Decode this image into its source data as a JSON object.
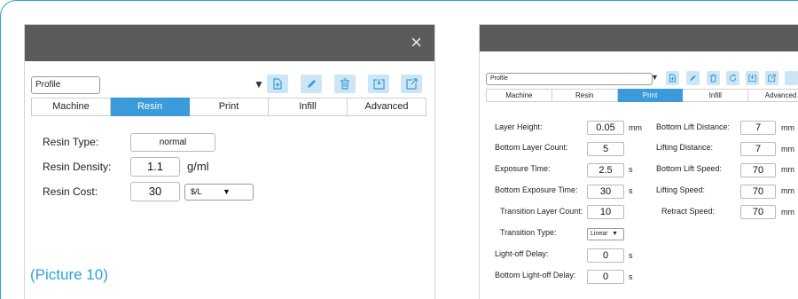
{
  "colors": {
    "accent": "#3b9ad9",
    "frame": "#2aa3d8",
    "titlebar": "#5a5b5d",
    "button_bg": "#cde6f5"
  },
  "left": {
    "close_glyph": "×",
    "profile": "Profile",
    "arrow_glyph": "▼",
    "tabs": [
      "Machine",
      "Resin",
      "Print",
      "Infill",
      "Advanced"
    ],
    "active_tab": "Resin",
    "resin_type_label": "Resin Type:",
    "resin_type_value": "normal",
    "resin_density_label": "Resin Density:",
    "resin_density_value": "1.1",
    "resin_density_unit": "g/ml",
    "resin_cost_label": "Resin Cost:",
    "resin_cost_value": "30",
    "resin_cost_currency": "$/L",
    "caption": "(Picture 10)"
  },
  "right": {
    "profile": "Profile",
    "arrow_glyph": "▼",
    "tabs": [
      "Machine",
      "Resin",
      "Print",
      "Infill",
      "Advanced"
    ],
    "active_tab": "Print",
    "layer_height_label": "Layer Height:",
    "layer_height_value": "0.05",
    "layer_height_unit": "mm",
    "bottom_layer_count_label": "Bottom Layer Count:",
    "bottom_layer_count_value": "5",
    "exposure_time_label": "Exposure Time:",
    "exposure_time_value": "2.5",
    "exposure_time_unit": "s",
    "bottom_exposure_label": "Bottom Exposure Time:",
    "bottom_exposure_value": "30",
    "bottom_exposure_unit": "s",
    "transition_count_label": "Transition Layer Count:",
    "transition_count_value": "10",
    "transition_type_label": "Transition Type:",
    "transition_type_value": "Linear",
    "light_off_label": "Light-off Delay:",
    "light_off_value": "0",
    "light_off_unit": "s",
    "bottom_light_off_label": "Bottom Light-off Delay:",
    "bottom_light_off_value": "0",
    "bottom_light_off_unit": "s",
    "bottom_lift_distance_label": "Bottom Lift Distance:",
    "bottom_lift_distance_value": "7",
    "bottom_lift_distance_unit": "mm",
    "lifting_distance_label": "Lifting Distance:",
    "lifting_distance_value": "7",
    "lifting_distance_unit": "mm",
    "bottom_lift_speed_label": "Bottom Lift Speed:",
    "bottom_lift_speed_value": "70",
    "bottom_lift_speed_unit": "mm",
    "lifting_speed_label": "Lifting Speed:",
    "lifting_speed_value": "70",
    "lifting_speed_unit": "mm",
    "retract_speed_label": "Retract Speed:",
    "retract_speed_value": "70",
    "retract_speed_unit": "mm"
  }
}
